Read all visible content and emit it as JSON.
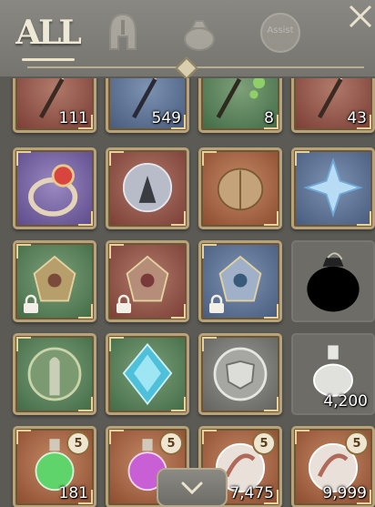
{
  "tabs": {
    "all_label": "ALL",
    "helmet_icon": "helmet-icon",
    "bag_icon": "pouch-icon",
    "assist_label": "Assist"
  },
  "inventory": {
    "row1": [
      {
        "item": "fishing-rod",
        "quantity": "111",
        "color": "red"
      },
      {
        "item": "fishing-rod",
        "quantity": "549",
        "color": "blue"
      },
      {
        "item": "fishing-rod",
        "quantity": "8",
        "color": "green"
      },
      {
        "item": "fishing-rod",
        "quantity": "43",
        "color": "red"
      }
    ],
    "row2": [
      {
        "item": "ruby-ring",
        "color": "purple"
      },
      {
        "item": "crystal-orb",
        "color": "red"
      },
      {
        "item": "golden-scarab",
        "color": "orange"
      },
      {
        "item": "blue-star-crystal",
        "color": "blue"
      }
    ],
    "row3": [
      {
        "item": "ornate-emblem",
        "color": "green",
        "locked": true
      },
      {
        "item": "ornate-emblem",
        "color": "red",
        "locked": true
      },
      {
        "item": "ornate-emblem",
        "color": "blue",
        "locked": true
      },
      {
        "item": "pouch",
        "color": "gray"
      }
    ],
    "row4": [
      {
        "item": "green-statue-medallion",
        "color": "green"
      },
      {
        "item": "blue-crystal-gem",
        "color": "green"
      },
      {
        "item": "silver-shield-crest",
        "color": "gray"
      },
      {
        "item": "potion-bottle",
        "quantity": "4,200",
        "color": "gray"
      }
    ],
    "row5": [
      {
        "item": "green-potion",
        "quantity": "181",
        "badge": "5",
        "color": "orange"
      },
      {
        "item": "purple-potion",
        "badge": "5",
        "color": "orange"
      },
      {
        "item": "feather-orb",
        "quantity": "7,475",
        "badge": "5",
        "color": "orange"
      },
      {
        "item": "feather-orb",
        "quantity": "9,999",
        "badge": "5",
        "color": "orange"
      }
    ]
  },
  "colors": {
    "background": "#5b5a55",
    "frame_gold": "#b7a27a",
    "text_white": "#ffffff"
  }
}
